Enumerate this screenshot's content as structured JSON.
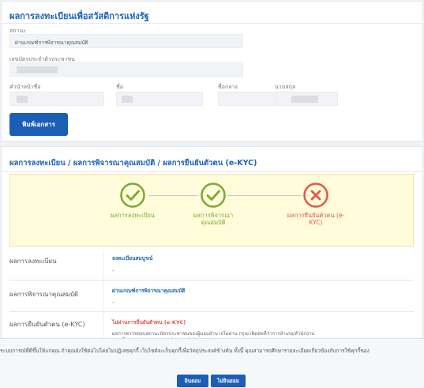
{
  "registration_section": {
    "title": "ผลการลงทะเบียนเพื่อสวัสดิการแห่งรัฐ",
    "status_label": "สถานะ",
    "status_value": "ผ่านเกณฑ์การพิจารณาคุณสมบัติ",
    "id_label": "เลขบัตรประจำตัวประชาชน",
    "prefix_label": "คำนำหน้าชื่อ",
    "firstname_label": "ชื่อ",
    "middlename_label": "ชื่อกลาง",
    "lastname_label": "นามสกุล",
    "print_button": "พิมพ์เอกสาร"
  },
  "result_section": {
    "title": "ผลการลงทะเบียน / ผลการพิจารณาคุณสมบัติ / ผลการยืนยันตัวตน (e-KYC)",
    "steps": [
      {
        "label": "ผลการลงทะเบียน",
        "state": "pass",
        "color": "#7bab2b"
      },
      {
        "label": "ผลการพิจารณา คุณสมบัติ",
        "state": "pass",
        "color": "#7bab2b"
      },
      {
        "label": "ผลการยืนยันตัวตน (e-KYC)",
        "state": "fail",
        "color": "#e2584a"
      }
    ],
    "rows": [
      {
        "label": "ผลการลงทะเบียน",
        "value": "ลงทะเบียนสมบูรณ์",
        "sub": "-"
      },
      {
        "label": "ผลการพิจารณาคุณสมบัติ",
        "value": "ผ่านเกณฑ์การพิจารณาคุณสมบัติ",
        "sub": "-"
      },
      {
        "label": "ผลการยืนยันตัวตน (e-KYC)",
        "value": "ไม่ผ่านการยืนยันตัวตน (e-KYC)",
        "note": "ผลการตรวจสอบสถานะบัตรประชาชนของผู้มอบอำนาจไม่ผ่าน กรุณาติดต่อที่ว่าการอำเภอ/สำนักงานเขตเพื่อตรวจสอบสถานะของบัตรประจำตัวประชาชน"
      }
    ]
  },
  "consent": {
    "text": "ระบบการณ์ที่ดีขึ้นให้แก่คุณ ถ้าคุณยังใช้ต่อไปโดยไม่ปฏิเสธคุกกี้ เว็บไซต์จะเก็บคุกกี้เพื่อวัตถุประสงค์ข้างต้น ทั้งนี้ คุณสามารถศึกษารายละเอียดเกี่ยวข้องกับการใช้คุกกี้ของ",
    "accept": "ยินยอม",
    "decline": "ไม่ยินยอม"
  },
  "colors": {
    "primary": "#1a5fb5",
    "pass": "#7bab2b",
    "fail": "#e2584a",
    "panel": "#fffbdb"
  }
}
